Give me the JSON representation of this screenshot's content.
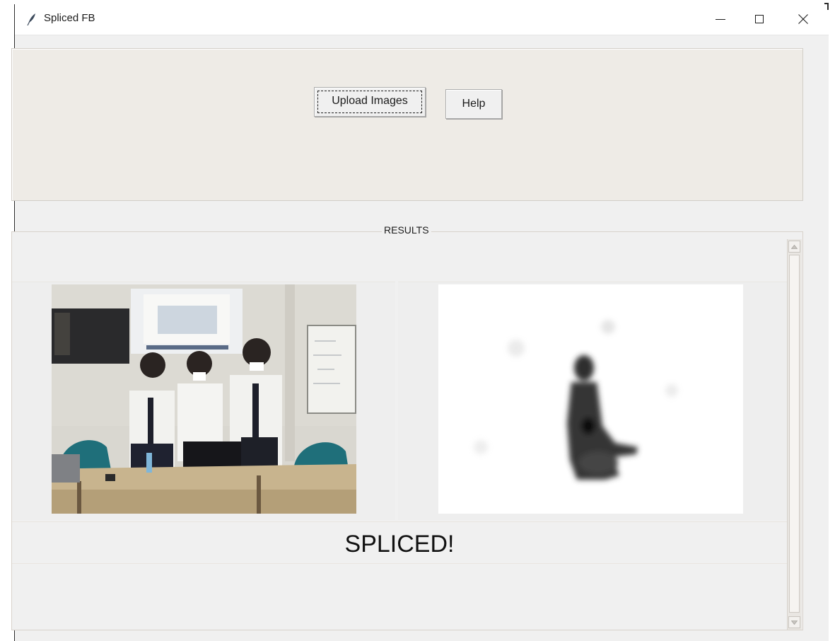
{
  "window": {
    "title": "Spliced FB"
  },
  "toolbar": {
    "upload_label": "Upload Images",
    "help_label": "Help"
  },
  "results": {
    "section_label": "RESULTS",
    "verdict": "SPLICED!"
  },
  "icons": {
    "app": "feather-icon",
    "minimize": "minimize-icon",
    "maximize": "maximize-icon",
    "close": "close-icon"
  }
}
